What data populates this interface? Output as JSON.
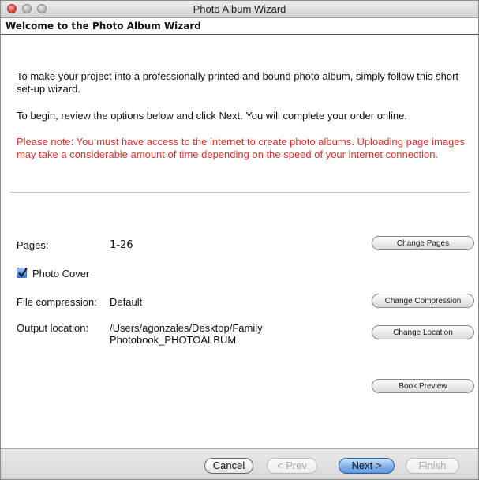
{
  "window": {
    "title": "Photo Album Wizard"
  },
  "header": {
    "heading": "Welcome to the Photo Album Wizard"
  },
  "intro": {
    "paragraph1": "To make your project into a professionally printed and bound photo album, simply follow this short set-up wizard.",
    "paragraph2": "To begin, review the options below and click Next. You will complete your order online.",
    "note": "Please note: You must have access to the internet to create photo albums. Uploading page images may take a considerable amount of time depending on the speed of your internet connection."
  },
  "colors": {
    "note_red": "#e0322a",
    "default_button_blue": "#5c97e0"
  },
  "options": {
    "pages_label": "Pages:",
    "pages_value": "1-26",
    "change_pages_label": "Change Pages",
    "photo_cover_label": "Photo Cover",
    "photo_cover_checked": true,
    "compression_label": "File compression:",
    "compression_value": "Default",
    "change_compression_label": "Change Compression",
    "output_label": "Output location:",
    "output_value_line1": "/Users/agonzales/Desktop/Family",
    "output_value_line2": "Photobook_PHOTOALBUM",
    "change_location_label": "Change Location",
    "book_preview_label": "Book Preview"
  },
  "footer": {
    "cancel_label": "Cancel",
    "prev_label": "< Prev",
    "next_label": "Next >",
    "finish_label": "Finish"
  }
}
